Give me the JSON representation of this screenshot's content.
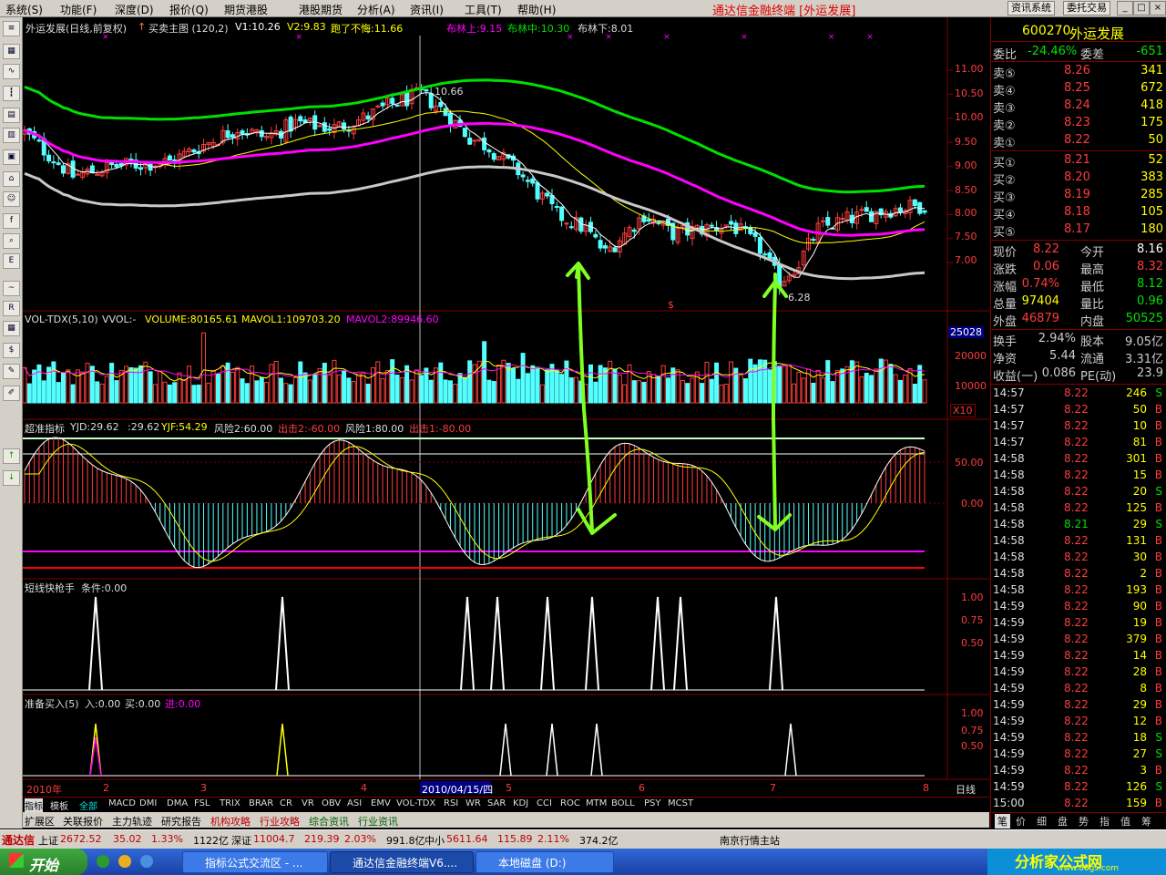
{
  "menu": {
    "items": [
      "系统(S)",
      "功能(F)",
      "深度(D)",
      "报价(Q)",
      "期货港股",
      "港股期货",
      "分析(A)",
      "资讯(I)",
      "工具(T)",
      "帮助(H)"
    ],
    "app_title": "通达信金融终端 [外运发展]",
    "btn_news": "资讯系统",
    "btn_trade": "委托交易",
    "win_btns": [
      "_",
      "□",
      "×"
    ]
  },
  "toolbar_icons": [
    "list-icon",
    "grid-icon",
    "line-chart-icon",
    "candle-icon",
    "doc-icon",
    "news-icon",
    "table-icon",
    "home-icon",
    "people-icon",
    "f10-icon",
    "search-icon",
    "eif-icon",
    "macd-icon",
    "rsi-icon",
    "chart2-icon",
    "dollar-icon",
    "tools-icon",
    "pen-icon",
    "up-arrow-icon",
    "down-arrow-icon"
  ],
  "colors": {
    "up": "#ff3c3c",
    "down": "#54ffff",
    "yellow": "#ffff00",
    "green": "#00e000",
    "magenta": "#ff00ff",
    "white": "#ffffff",
    "grey": "#c8c8c8",
    "arrow": "#80ff20"
  },
  "kline": {
    "title": "外运发展(日线,前复权)",
    "indicator": "买卖主图 (120,2)",
    "v1": "V1:10.26",
    "v2": "V2:9.83",
    "paoliao": "跑了不悔:11.66",
    "boll_up": "布林上:9.15",
    "boll_mid": "布林中:10.30",
    "boll_low": "布林下:8.01",
    "high_mark": "10.66",
    "low_mark": "6.28",
    "axis": [
      "11.00",
      "10.50",
      "10.00",
      "9.50",
      "9.00",
      "8.50",
      "8.00",
      "7.50",
      "7.00"
    ],
    "dollar": "$"
  },
  "volume": {
    "title": "VOL-TDX(5,10)",
    "vvol": "VVOL:-",
    "volume": "VOLUME:80165.61",
    "mavol1": "MAVOL1:109703.20",
    "mavol2": "MAVOL2:89946.60",
    "cur": "25028",
    "axis": [
      "20000",
      "10000"
    ],
    "x10": "X10"
  },
  "sup": {
    "title": "超准指标",
    "yjd": "YJD:29.62",
    "val": ":29.62",
    "yjf": "YJF:54.29",
    "fx2": "风险2:60.00",
    "cj2": "出击2:-60.00",
    "fx1": "风险1:80.00",
    "cj1": "出击1:-80.00",
    "axis": [
      "50.00",
      "0.00"
    ]
  },
  "short": {
    "title": "短线快枪手",
    "cond": "条件:0.00",
    "axis": [
      "1.00",
      "0.75",
      "0.50"
    ]
  },
  "prep": {
    "title": "准备买入(5)",
    "ru": "入:0.00",
    "mai": "买:0.00",
    "jin": "进:0.00",
    "axis": [
      "1.00",
      "0.75",
      "0.50"
    ]
  },
  "dates": {
    "year": "2010年",
    "m2": "2",
    "m3": "3",
    "m4": "4",
    "cur": "2010/04/15/四",
    "m5": "5",
    "m6": "6",
    "m7": "7",
    "m8": "8",
    "period": "日线"
  },
  "tabs": [
    "指标",
    "模板",
    "全部",
    "MACD",
    "DMI",
    "DMA",
    "FSL",
    "TRIX",
    "BRAR",
    "CR",
    "VR",
    "OBV",
    "ASI",
    "EMV",
    "VOL-TDX",
    "RSI",
    "WR",
    "SAR",
    "KDJ",
    "CCI",
    "ROC",
    "MTM",
    "BOLL",
    "PSY",
    "MCST"
  ],
  "tabs2": [
    "扩展区",
    "关联报价",
    "主力轨迹",
    "研究报告",
    "机构攻略",
    "行业攻略",
    "综合资讯",
    "行业资讯"
  ],
  "stock": {
    "code": "600270",
    "name": "外运发展",
    "weibi_label": "委比",
    "weibi": "-24.46%",
    "weicha_label": "委差",
    "weicha": "-651",
    "sell": [
      {
        "label": "卖⑤",
        "price": "8.26",
        "vol": "341"
      },
      {
        "label": "卖④",
        "price": "8.25",
        "vol": "672"
      },
      {
        "label": "卖③",
        "price": "8.24",
        "vol": "418"
      },
      {
        "label": "卖②",
        "price": "8.23",
        "vol": "175"
      },
      {
        "label": "卖①",
        "price": "8.22",
        "vol": "50"
      }
    ],
    "buy": [
      {
        "label": "买①",
        "price": "8.21",
        "vol": "52"
      },
      {
        "label": "买②",
        "price": "8.20",
        "vol": "383"
      },
      {
        "label": "买③",
        "price": "8.19",
        "vol": "285"
      },
      {
        "label": "买④",
        "price": "8.18",
        "vol": "105"
      },
      {
        "label": "买⑤",
        "price": "8.17",
        "vol": "180"
      }
    ],
    "stats": [
      {
        "l1": "现价",
        "v1": "8.22",
        "l2": "今开",
        "v2": "8.16",
        "c1": "#ff3c3c",
        "c2": "#ffffff"
      },
      {
        "l1": "涨跌",
        "v1": "0.06",
        "l2": "最高",
        "v2": "8.32",
        "c1": "#ff3c3c",
        "c2": "#ff3c3c"
      },
      {
        "l1": "涨幅",
        "v1": "0.74%",
        "l2": "最低",
        "v2": "8.12",
        "c1": "#ff3c3c",
        "c2": "#00e000"
      },
      {
        "l1": "总量",
        "v1": "97404",
        "l2": "量比",
        "v2": "0.96",
        "c1": "#ffff00",
        "c2": "#00e000"
      },
      {
        "l1": "外盘",
        "v1": "46879",
        "l2": "内盘",
        "v2": "50525",
        "c1": "#ff3c3c",
        "c2": "#00e000"
      }
    ],
    "stats2": [
      {
        "l1": "换手",
        "v1": "2.94%",
        "l2": "股本",
        "v2": "9.05亿"
      },
      {
        "l1": "净资",
        "v1": "5.44",
        "l2": "流通",
        "v2": "3.31亿"
      },
      {
        "l1": "收益(一)",
        "v1": "0.086",
        "l2": "PE(动)",
        "v2": "23.9"
      }
    ],
    "ticks": [
      {
        "t": "14:57",
        "p": "8.22",
        "v": "246",
        "s": "S"
      },
      {
        "t": "14:57",
        "p": "8.22",
        "v": "50",
        "s": "B"
      },
      {
        "t": "14:57",
        "p": "8.22",
        "v": "10",
        "s": "B"
      },
      {
        "t": "14:57",
        "p": "8.22",
        "v": "81",
        "s": "B"
      },
      {
        "t": "14:58",
        "p": "8.22",
        "v": "301",
        "s": "B"
      },
      {
        "t": "14:58",
        "p": "8.22",
        "v": "15",
        "s": "B"
      },
      {
        "t": "14:58",
        "p": "8.22",
        "v": "20",
        "s": "S"
      },
      {
        "t": "14:58",
        "p": "8.22",
        "v": "125",
        "s": "B"
      },
      {
        "t": "14:58",
        "p": "8.21",
        "v": "29",
        "s": "S"
      },
      {
        "t": "14:58",
        "p": "8.22",
        "v": "131",
        "s": "B"
      },
      {
        "t": "14:58",
        "p": "8.22",
        "v": "30",
        "s": "B"
      },
      {
        "t": "14:58",
        "p": "8.22",
        "v": "2",
        "s": "B"
      },
      {
        "t": "14:58",
        "p": "8.22",
        "v": "193",
        "s": "B"
      },
      {
        "t": "14:59",
        "p": "8.22",
        "v": "90",
        "s": "B"
      },
      {
        "t": "14:59",
        "p": "8.22",
        "v": "19",
        "s": "B"
      },
      {
        "t": "14:59",
        "p": "8.22",
        "v": "379",
        "s": "B"
      },
      {
        "t": "14:59",
        "p": "8.22",
        "v": "14",
        "s": "B"
      },
      {
        "t": "14:59",
        "p": "8.22",
        "v": "28",
        "s": "B"
      },
      {
        "t": "14:59",
        "p": "8.22",
        "v": "8",
        "s": "B"
      },
      {
        "t": "14:59",
        "p": "8.22",
        "v": "29",
        "s": "B"
      },
      {
        "t": "14:59",
        "p": "8.22",
        "v": "12",
        "s": "B"
      },
      {
        "t": "14:59",
        "p": "8.22",
        "v": "18",
        "s": "S"
      },
      {
        "t": "14:59",
        "p": "8.22",
        "v": "27",
        "s": "S"
      },
      {
        "t": "14:59",
        "p": "8.22",
        "v": "3",
        "s": "B"
      },
      {
        "t": "14:59",
        "p": "8.22",
        "v": "126",
        "s": "S"
      },
      {
        "t": "15:00",
        "p": "8.22",
        "v": "159",
        "s": "B"
      }
    ],
    "bottom_tabs": [
      "笔",
      "价",
      "细",
      "盘",
      "势",
      "指",
      "值",
      "筹"
    ]
  },
  "status": {
    "brand": "通达信",
    "sh_label": "上证",
    "sh_val": "2672.52",
    "sh_chg": "35.02",
    "sh_pct": "1.33%",
    "sh_amt": "1122亿",
    "sz_label": "深证",
    "sz_val": "11004.7",
    "sz_chg": "219.39",
    "sz_pct": "2.03%",
    "sz_amt": "991.8亿",
    "zx_label": "中小",
    "zx_val": "5611.64",
    "zx_chg": "115.89",
    "zx_pct": "2.11%",
    "zx_amt": "374.2亿",
    "server": "南京行情主站"
  },
  "taskbar": {
    "start": "开始",
    "tasks": [
      "指标公式交流区 - ...",
      "通达信金融终端V6....",
      "本地磁盘 (D:)"
    ],
    "logo": "分析家公式网",
    "logo_url": "www.88gs.com"
  }
}
